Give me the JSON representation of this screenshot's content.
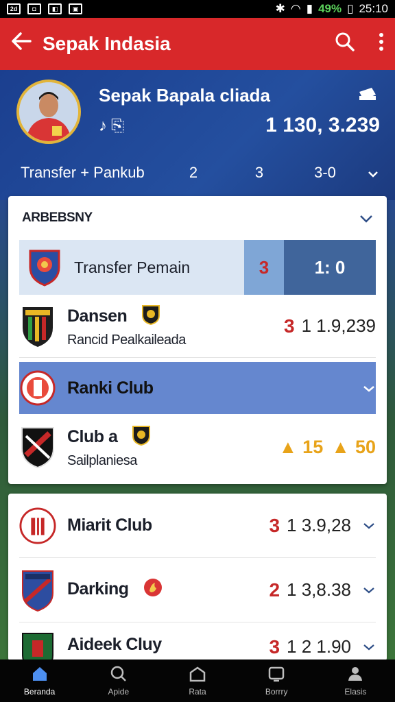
{
  "status_bar": {
    "battery": "49%",
    "time": "25:10"
  },
  "app_bar": {
    "title": "Sepak Indasia"
  },
  "hero": {
    "name": "Sepak Bapala cliada",
    "score": "1 130, 3.239",
    "row_label": "Transfer + Pankub",
    "col1": "2",
    "col2": "3",
    "col3": "3-0"
  },
  "card1": {
    "header": "ARBEBSNY",
    "transfer": {
      "label": "Transfer Pemain",
      "seg1": "3",
      "seg2": "1: 0"
    },
    "rows": [
      {
        "name": "Dansen",
        "sub": "Rancid Pealkaileada",
        "rank": "3",
        "value": "1 1.9,239"
      },
      {
        "name": "Ranki Club"
      },
      {
        "name": "Club a",
        "sub": "Sailplaniesa",
        "value1": "15",
        "value2": "50"
      }
    ]
  },
  "card2": {
    "rows": [
      {
        "name": "Miarit Club",
        "rank": "3",
        "value": "1 3.9,28"
      },
      {
        "name": "Darking",
        "rank": "2",
        "value": "1 3,8.38"
      },
      {
        "name": "Aideek Cluy",
        "rank": "3",
        "value": "1 2 1.90"
      }
    ]
  },
  "bottom_nav": {
    "items": [
      {
        "label": "Beranda",
        "icon": "home-icon"
      },
      {
        "label": "Apide",
        "icon": "search-icon"
      },
      {
        "label": "Rata",
        "icon": "stadium-icon"
      },
      {
        "label": "Borrry",
        "icon": "tv-icon"
      },
      {
        "label": "Elasis",
        "icon": "profile-icon"
      }
    ]
  },
  "colors": {
    "app_bar": "#d8282a",
    "accent_red": "#c62828",
    "accent_gold": "#e8a319",
    "highlight_blue": "#6587cf"
  }
}
